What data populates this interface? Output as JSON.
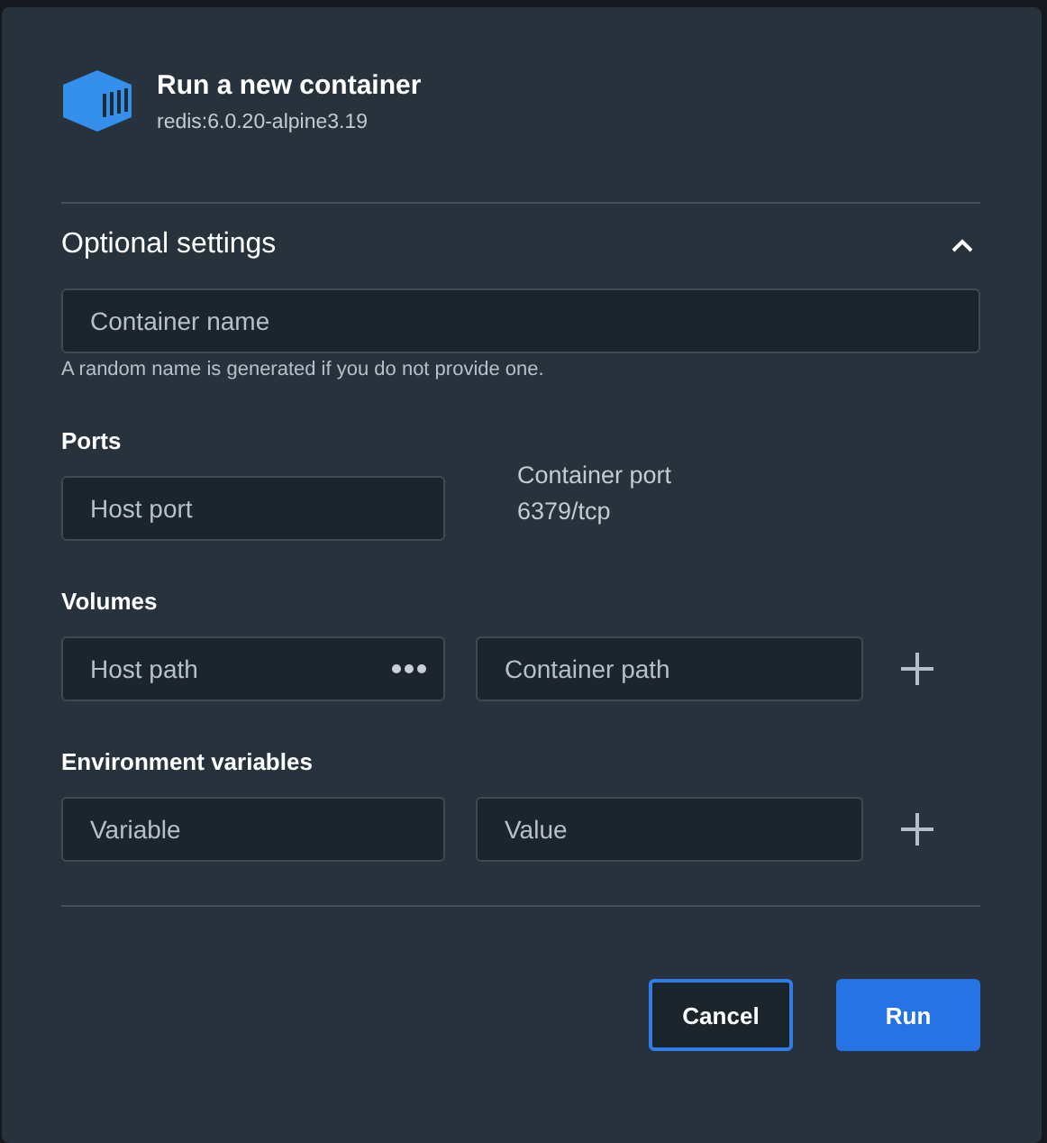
{
  "dialog": {
    "title": "Run a new container",
    "subtitle": "redis:6.0.20-alpine3.19"
  },
  "optional_settings": {
    "title": "Optional settings",
    "expanded": true,
    "container_name": {
      "placeholder": "Container name",
      "hint": "A random name is generated if you do not provide one."
    },
    "ports": {
      "title": "Ports",
      "host_port": {
        "placeholder": "Host port"
      },
      "container_port_label": "Container port",
      "container_port": "6379/tcp"
    },
    "volumes": {
      "title": "Volumes",
      "host_path": {
        "placeholder": "Host path"
      },
      "container_path": {
        "placeholder": "Container path"
      }
    },
    "environment": {
      "title": "Environment variables",
      "variable": {
        "placeholder": "Variable"
      },
      "value": {
        "placeholder": "Value"
      }
    }
  },
  "buttons": [
    {
      "label": "Cancel",
      "kind": "secondary"
    },
    {
      "label": "Run",
      "kind": "primary"
    }
  ]
}
